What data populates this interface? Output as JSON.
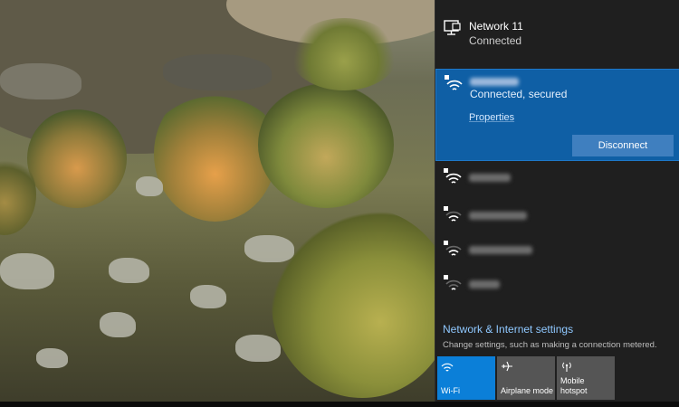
{
  "flyout": {
    "ethernet": {
      "name": "Network 11",
      "status": "Connected",
      "icon": "ethernet-monitor-icon"
    },
    "selected_network": {
      "name": "",
      "status": "Connected, secured",
      "properties_label": "Properties",
      "disconnect_label": "Disconnect",
      "icon": "wifi-secured-icon"
    },
    "other_networks": [
      {
        "name": "",
        "icon": "wifi-secured-icon"
      },
      {
        "name": "",
        "icon": "wifi-secured-icon"
      },
      {
        "name": "",
        "icon": "wifi-secured-icon"
      },
      {
        "name": "",
        "icon": "wifi-secured-icon"
      }
    ],
    "settings": {
      "title": "Network & Internet settings",
      "description": "Change settings, such as making a connection metered."
    },
    "quick_actions": [
      {
        "label": "Wi-Fi",
        "icon": "wifi-icon",
        "active": true
      },
      {
        "label": "Airplane mode",
        "icon": "airplane-icon",
        "active": false
      },
      {
        "label": "Mobile\nhotspot",
        "icon": "hotspot-icon",
        "active": false
      }
    ]
  },
  "colors": {
    "accent": "#0f5fa5",
    "flyout_bg": "#1f1f1f",
    "tile_inactive": "#555555",
    "link": "#8fc8ff"
  }
}
